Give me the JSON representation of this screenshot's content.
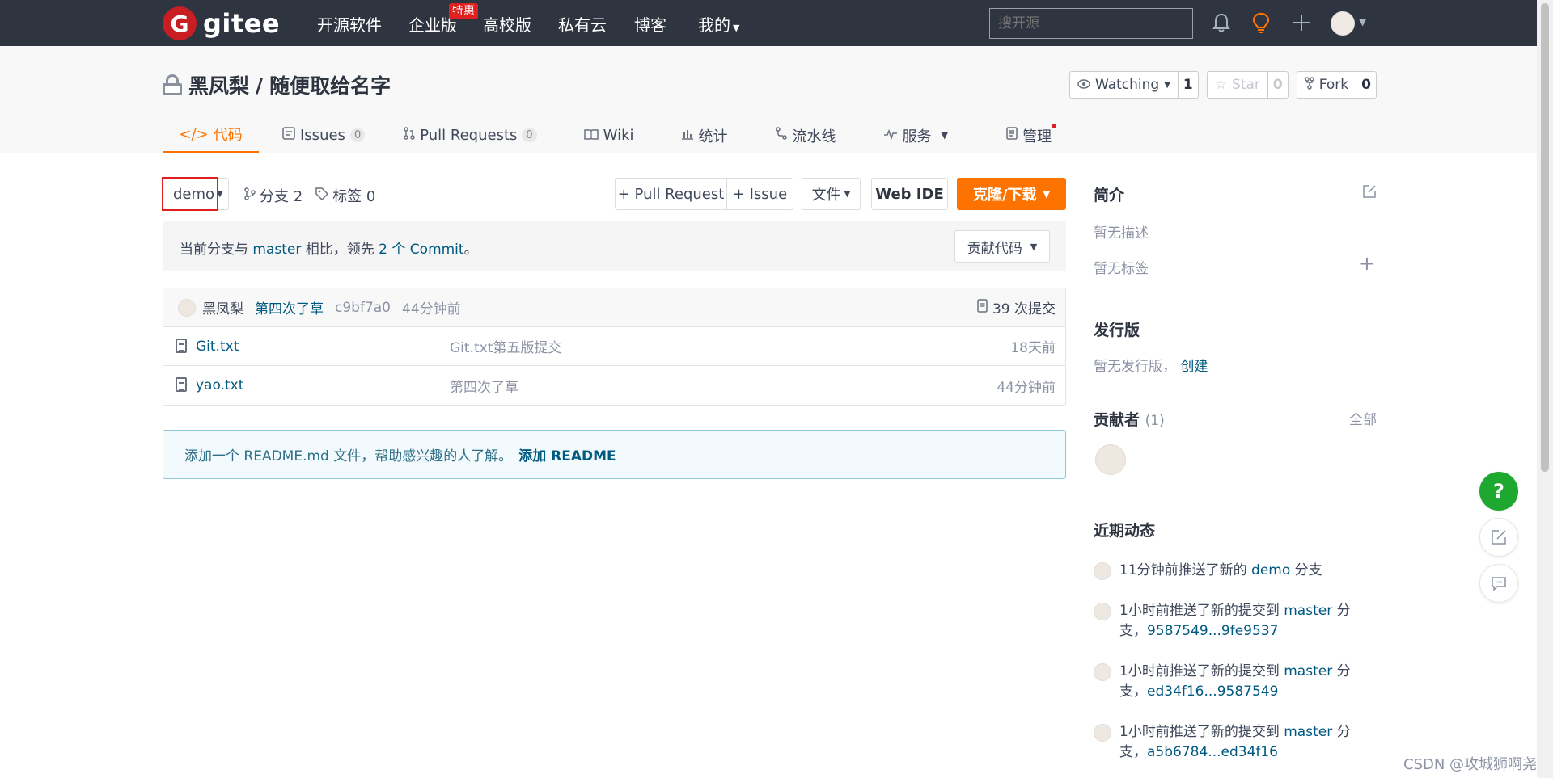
{
  "topnav": {
    "logo_letter": "G",
    "logo_text": "gitee",
    "items": [
      "开源软件",
      "企业版",
      "高校版",
      "私有云",
      "博客",
      "我的"
    ],
    "badge": "特惠",
    "search_placeholder": "搜开源"
  },
  "repo": {
    "owner": "黑凤梨",
    "separator": "/",
    "name": "随便取给名字",
    "watching_label": "Watching",
    "watching_count": "1",
    "star_label": "Star",
    "star_count": "0",
    "fork_label": "Fork",
    "fork_count": "0"
  },
  "tabs": {
    "code": "代码",
    "issues": "Issues",
    "issues_count": "0",
    "pulls": "Pull Requests",
    "pulls_count": "0",
    "wiki": "Wiki",
    "stats": "统计",
    "pipeline": "流水线",
    "service": "服务",
    "manage": "管理"
  },
  "toolbar": {
    "branch": "demo",
    "branches": "分支 2",
    "tags": "标签 0",
    "pull_request": "+ Pull Request",
    "issue": "+ Issue",
    "file": "文件",
    "web_ide": "Web IDE",
    "clone": "克隆/下载"
  },
  "compare": {
    "prefix": "当前分支与",
    "base": "master",
    "middle": "相比，领先",
    "ahead": "2 个 Commit",
    "suffix": "。",
    "contribute": "贡献代码"
  },
  "last_commit": {
    "author": "黑凤梨",
    "message": "第四次了草",
    "sha": "c9bf7a0",
    "ago": "44分钟前",
    "total": "39 次提交"
  },
  "files": [
    {
      "name": "Git.txt",
      "message": "Git.txt第五版提交",
      "time": "18天前"
    },
    {
      "name": "yao.txt",
      "message": "第四次了草",
      "time": "44分钟前"
    }
  ],
  "readme": {
    "text": "添加一个 README.md 文件，帮助感兴趣的人了解。",
    "action": "添加 README"
  },
  "sidebar": {
    "intro_title": "简介",
    "no_desc": "暂无描述",
    "no_tags": "暂无标签",
    "release_title": "发行版",
    "no_release": "暂无发行版，",
    "create": "创建",
    "contributors_title": "贡献者",
    "contributors_count": "(1)",
    "all": "全部",
    "activity_title": "近期动态",
    "activities": [
      {
        "prefix": "11分钟前推送了新的",
        "branch": "demo",
        "suffix": "分支",
        "range": ""
      },
      {
        "prefix": "1小时前推送了新的提交到",
        "branch": "master",
        "suffix": "分支，",
        "range": "9587549...9fe9537"
      },
      {
        "prefix": "1小时前推送了新的提交到",
        "branch": "master",
        "suffix": "分支，",
        "range": "ed34f16...9587549"
      },
      {
        "prefix": "1小时前推送了新的提交到",
        "branch": "master",
        "suffix": "分支，",
        "range": "a5b6784...ed34f16"
      }
    ]
  },
  "floating": {
    "help": "?"
  },
  "watermark": "CSDN @攻城狮啊尧"
}
